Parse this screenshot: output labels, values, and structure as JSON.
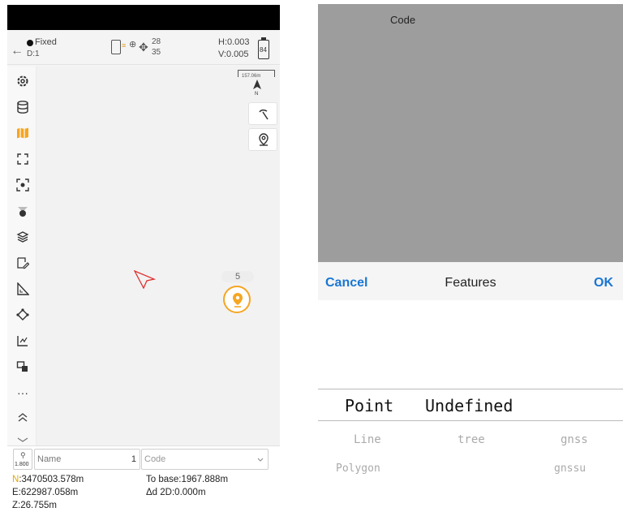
{
  "left": {
    "topbar": {
      "fix_status": "Fixed",
      "differential": "D:1",
      "sat_used": "28",
      "sat_total": "35",
      "h_precision": "H:0.003",
      "v_precision": "V:0.005",
      "battery": "84"
    },
    "map": {
      "scale_label": "157.06m",
      "north_label": "N",
      "point_count": "5"
    },
    "bottom": {
      "antenna_height": "1.800",
      "name_placeholder": "Name",
      "name_index": "1",
      "code_placeholder": "Code",
      "n_label": "N",
      "n_value": ":3470503.578m",
      "e_value": "E:622987.058m",
      "z_value": "Z:26.755m",
      "to_base": "To base:1967.888m",
      "delta_2d": "Δd 2D:0.000m"
    },
    "toolbar": {
      "more": "···"
    }
  },
  "right": {
    "code_label": "Code",
    "cancel": "Cancel",
    "title": "Features",
    "ok": "OK",
    "picker": {
      "selected": [
        "Point",
        "Undefined"
      ],
      "row2": [
        "Line",
        "tree",
        "gnss"
      ],
      "row3": [
        "Polygon",
        "gnssu"
      ]
    }
  },
  "colors": {
    "accent": "#1976d2",
    "toolbar_highlight": "#f5a623",
    "dimmer": "#9d9d9d"
  }
}
